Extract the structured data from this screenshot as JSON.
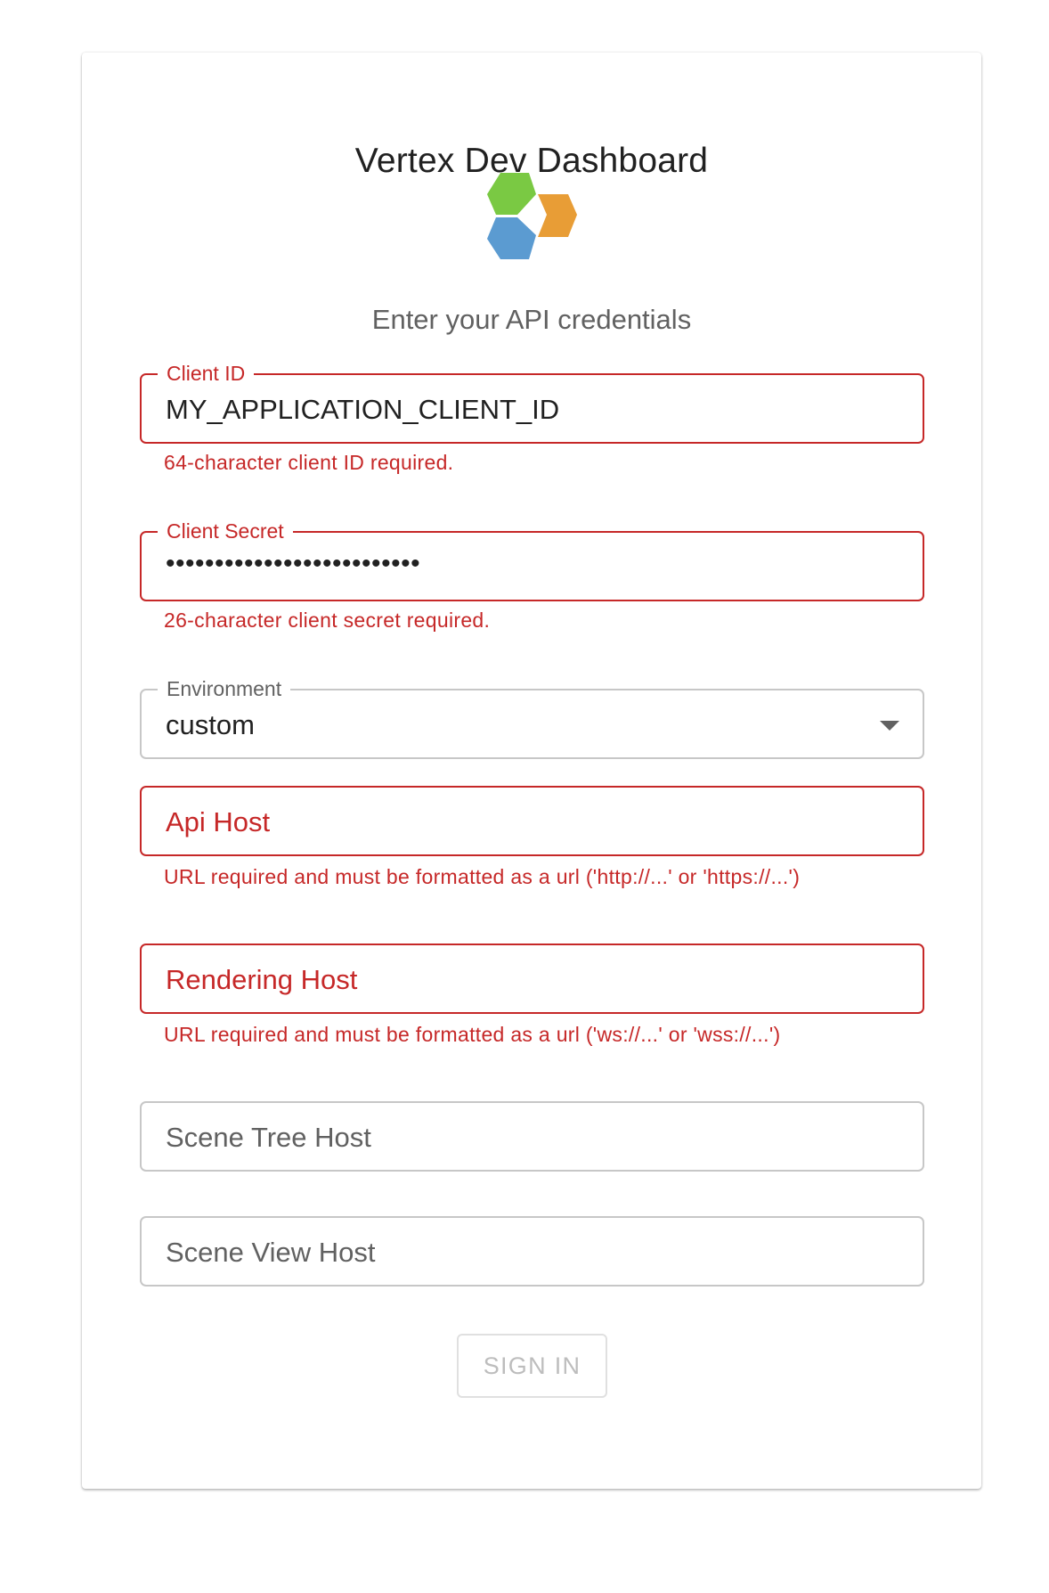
{
  "app": {
    "title": "Vertex Dev Dashboard",
    "subtitle": "Enter your API credentials",
    "logo_icon": "vertex-hexagon-logo"
  },
  "form": {
    "client_id": {
      "label": "Client ID",
      "value": "MY_APPLICATION_CLIENT_ID",
      "helper": "64-character client ID required."
    },
    "client_secret": {
      "label": "Client Secret",
      "value": "••••••••••••••••••••••••••",
      "helper": "26-character client secret required."
    },
    "environment": {
      "label": "Environment",
      "value": "custom"
    },
    "api_host": {
      "placeholder": "Api Host",
      "helper": "URL required and must be formatted as a url ('http://...' or 'https://...')"
    },
    "rendering_host": {
      "placeholder": "Rendering Host",
      "helper": "URL required and must be formatted as a url ('ws://...' or 'wss://...')"
    },
    "scene_tree_host": {
      "placeholder": "Scene Tree Host"
    },
    "scene_view_host": {
      "placeholder": "Scene View Host"
    },
    "submit_label": "SIGN IN"
  },
  "colors": {
    "error": "#c62828",
    "border": "#c7c7c7",
    "logo_green": "#7ac943",
    "logo_orange": "#e89d36",
    "logo_blue": "#5b9bd1"
  }
}
